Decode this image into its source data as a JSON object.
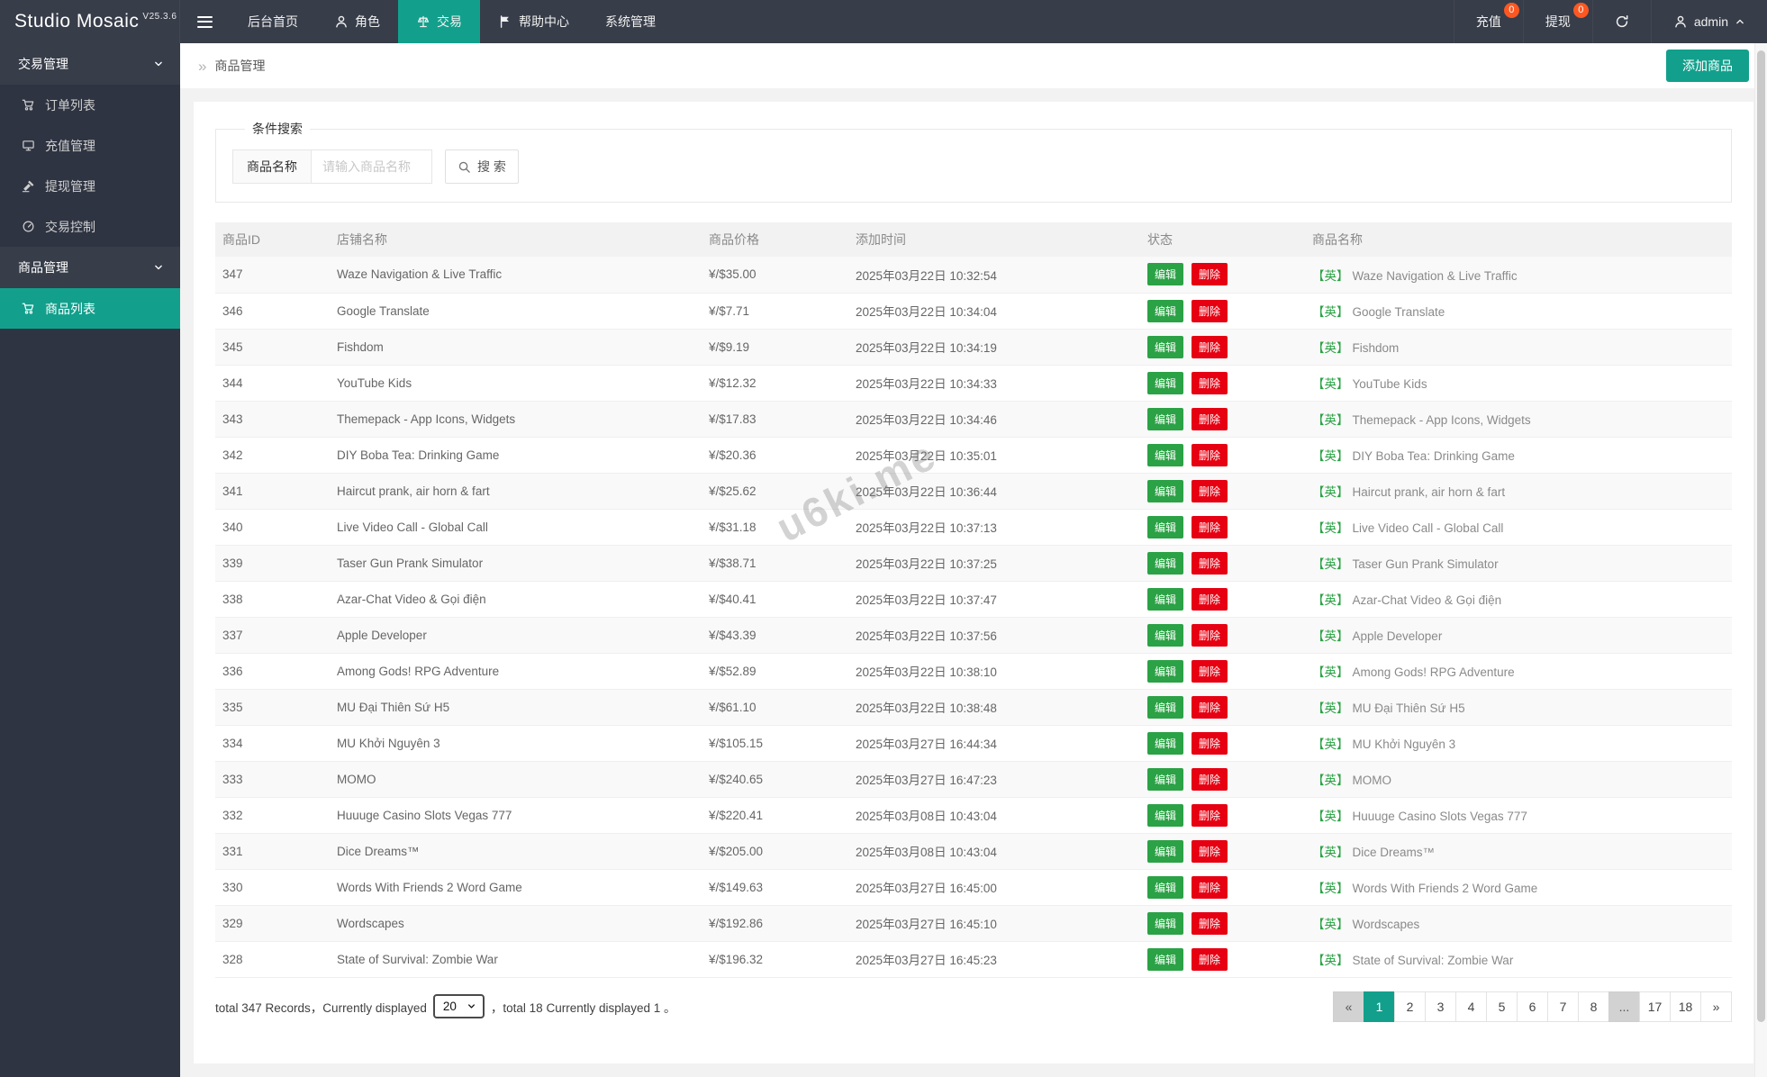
{
  "navbar": {
    "brand": "Studio Mosaic",
    "version": "V25.3.6",
    "items": [
      {
        "key": "dashboard",
        "label": "后台首页",
        "icon": null,
        "active": false
      },
      {
        "key": "roles",
        "label": "角色",
        "icon": "user",
        "active": false
      },
      {
        "key": "trade",
        "label": "交易",
        "icon": "scales",
        "active": true
      },
      {
        "key": "help-center",
        "label": "帮助中心",
        "icon": "flag",
        "active": false
      },
      {
        "key": "system",
        "label": "系统管理",
        "icon": null,
        "active": false
      }
    ],
    "right_items": [
      {
        "key": "recharge",
        "label": "充值",
        "badge": "0"
      },
      {
        "key": "withdraw",
        "label": "提现",
        "badge": "0"
      }
    ],
    "user": "admin"
  },
  "sidebar": {
    "sections": [
      {
        "key": "trade-mgmt",
        "title": "交易管理",
        "items": [
          {
            "key": "order-list",
            "icon": "cart",
            "label": "订单列表",
            "active": false
          },
          {
            "key": "recharge-mgmt",
            "icon": "display",
            "label": "充值管理",
            "active": false
          },
          {
            "key": "withdraw-mgmt",
            "icon": "gavel",
            "label": "提现管理",
            "active": false
          },
          {
            "key": "trade-control",
            "icon": "gauge",
            "label": "交易控制",
            "active": false
          }
        ]
      },
      {
        "key": "product-mgmt",
        "title": "商品管理",
        "items": [
          {
            "key": "product-list",
            "icon": "cart",
            "label": "商品列表",
            "active": true
          }
        ]
      }
    ]
  },
  "breadcrumb": {
    "icon": "»",
    "label": "商品管理"
  },
  "add_button_label": "添加商品",
  "search": {
    "legend": "条件搜索",
    "field_label": "商品名称",
    "placeholder": "请输入商品名称",
    "button_label": "搜 索"
  },
  "table": {
    "headers": [
      "商品ID",
      "店铺名称",
      "商品价格",
      "添加时间",
      "状态",
      "商品名称"
    ],
    "edit_label": "编辑",
    "delete_label": "删除",
    "lang_tag": "【英】",
    "rows": [
      {
        "id": "347",
        "shop": "Waze Navigation & Live Traffic",
        "price": "¥/$35.00",
        "time": "2025年03月22日 10:32:54",
        "name": "Waze Navigation & Live Traffic"
      },
      {
        "id": "346",
        "shop": "Google Translate",
        "price": "¥/$7.71",
        "time": "2025年03月22日 10:34:04",
        "name": "Google Translate"
      },
      {
        "id": "345",
        "shop": "Fishdom",
        "price": "¥/$9.19",
        "time": "2025年03月22日 10:34:19",
        "name": "Fishdom"
      },
      {
        "id": "344",
        "shop": "YouTube Kids",
        "price": "¥/$12.32",
        "time": "2025年03月22日 10:34:33",
        "name": "YouTube Kids"
      },
      {
        "id": "343",
        "shop": "Themepack - App Icons, Widgets",
        "price": "¥/$17.83",
        "time": "2025年03月22日 10:34:46",
        "name": "Themepack - App Icons, Widgets"
      },
      {
        "id": "342",
        "shop": "DIY Boba Tea: Drinking Game",
        "price": "¥/$20.36",
        "time": "2025年03月22日 10:35:01",
        "name": "DIY Boba Tea: Drinking Game"
      },
      {
        "id": "341",
        "shop": "Haircut prank, air horn & fart",
        "price": "¥/$25.62",
        "time": "2025年03月22日 10:36:44",
        "name": "Haircut prank, air horn & fart"
      },
      {
        "id": "340",
        "shop": "Live Video Call - Global Call",
        "price": "¥/$31.18",
        "time": "2025年03月22日 10:37:13",
        "name": "Live Video Call - Global Call"
      },
      {
        "id": "339",
        "shop": "Taser Gun Prank Simulator",
        "price": "¥/$38.71",
        "time": "2025年03月22日 10:37:25",
        "name": "Taser Gun Prank Simulator"
      },
      {
        "id": "338",
        "shop": "Azar-Chat Video & Gọi điện",
        "price": "¥/$40.41",
        "time": "2025年03月22日 10:37:47",
        "name": "Azar-Chat Video & Gọi điện"
      },
      {
        "id": "337",
        "shop": "Apple Developer",
        "price": "¥/$43.39",
        "time": "2025年03月22日 10:37:56",
        "name": "Apple Developer"
      },
      {
        "id": "336",
        "shop": "Among Gods! RPG Adventure",
        "price": "¥/$52.89",
        "time": "2025年03月22日 10:38:10",
        "name": "Among Gods! RPG Adventure"
      },
      {
        "id": "335",
        "shop": "MU Đại Thiên Sứ H5",
        "price": "¥/$61.10",
        "time": "2025年03月22日 10:38:48",
        "name": "MU Đại Thiên Sứ H5"
      },
      {
        "id": "334",
        "shop": "MU Khởi Nguyên 3",
        "price": "¥/$105.15",
        "time": "2025年03月27日 16:44:34",
        "name": "MU Khởi Nguyên 3"
      },
      {
        "id": "333",
        "shop": "MOMO",
        "price": "¥/$240.65",
        "time": "2025年03月27日 16:47:23",
        "name": "MOMO"
      },
      {
        "id": "332",
        "shop": "Huuuge Casino Slots Vegas 777",
        "price": "¥/$220.41",
        "time": "2025年03月08日 10:43:04",
        "name": "Huuuge Casino Slots Vegas 777"
      },
      {
        "id": "331",
        "shop": "Dice Dreams™",
        "price": "¥/$205.00",
        "time": "2025年03月08日 10:43:04",
        "name": "Dice Dreams™"
      },
      {
        "id": "330",
        "shop": "Words With Friends 2 Word Game",
        "price": "¥/$149.63",
        "time": "2025年03月27日 16:45:00",
        "name": "Words With Friends 2 Word Game"
      },
      {
        "id": "329",
        "shop": "Wordscapes",
        "price": "¥/$192.86",
        "time": "2025年03月27日 16:45:10",
        "name": "Wordscapes"
      },
      {
        "id": "328",
        "shop": "State of Survival: Zombie War",
        "price": "¥/$196.32",
        "time": "2025年03月27日 16:45:23",
        "name": "State of Survival: Zombie War"
      }
    ]
  },
  "footer": {
    "summary_prefix": "total 347 Records，Currently displayed",
    "page_size": "20",
    "summary_suffix": "，total 18 Currently displayed 1 。",
    "pagination": [
      {
        "label": "«",
        "style": "muted"
      },
      {
        "label": "1",
        "style": "active"
      },
      {
        "label": "2"
      },
      {
        "label": "3"
      },
      {
        "label": "4"
      },
      {
        "label": "5"
      },
      {
        "label": "6"
      },
      {
        "label": "7"
      },
      {
        "label": "8"
      },
      {
        "label": "...",
        "style": "muted"
      },
      {
        "label": "17"
      },
      {
        "label": "18"
      },
      {
        "label": "»"
      }
    ]
  },
  "watermark": "u6ki.me",
  "colors": {
    "accent": "#12a08c",
    "navbar_bg": "#373d49",
    "sidebar_bg": "#2f3442",
    "badge": "#ff5722",
    "edit_green": "#2ba245",
    "delete_red": "#e60012"
  }
}
